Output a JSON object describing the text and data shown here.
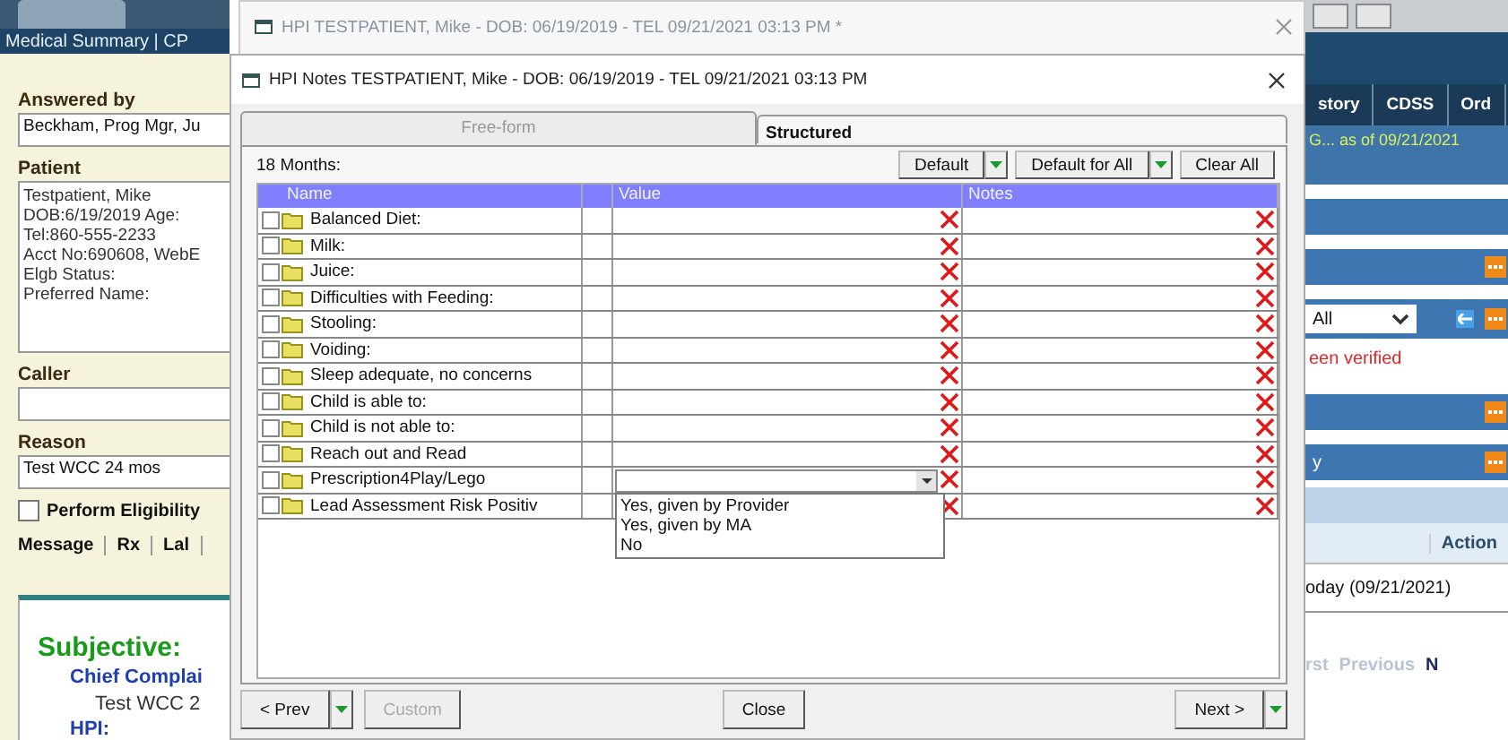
{
  "left_panel": {
    "nav_label": "Medical Summary | CP",
    "answered_by": {
      "label": "Answered by",
      "value": "Beckham, Prog Mgr, Ju"
    },
    "patient": {
      "label": "Patient",
      "lines": [
        "Testpatient, Mike",
        "DOB:6/19/2019  Age:",
        "Tel:860-555-2233",
        "Acct No:690608, WebE",
        "Elgb Status:",
        "Preferred Name:"
      ]
    },
    "caller": {
      "label": "Caller"
    },
    "reason": {
      "label": "Reason",
      "value": "Test WCC 24 mos"
    },
    "eligibility": {
      "label": "Perform Eligibility",
      "checked": false
    },
    "tabs": [
      "Message",
      "Rx",
      "Lal"
    ],
    "note": {
      "heading": "Subjective:",
      "subheading": "Chief Complai",
      "text": "Test WCC 2",
      "section": "HPI:"
    }
  },
  "right_panel": {
    "tabs": [
      "story",
      "CDSS",
      "Ord"
    ],
    "status": "G... as of 09/21/2021",
    "filter": {
      "value": "All"
    },
    "warning": "een verified",
    "bar_label": "y",
    "table": {
      "column": "Action",
      "cell": "oday (09/21/2021)"
    },
    "pager": [
      {
        "label": "rst",
        "disabled": true
      },
      {
        "label": "Previous",
        "disabled": true
      },
      {
        "label": "N",
        "disabled": false
      }
    ]
  },
  "back_window": {
    "title": "HPI TESTPATIENT, Mike - DOB: 06/19/2019 - TEL 09/21/2021 03:13 PM *"
  },
  "dialog": {
    "title": "HPI Notes TESTPATIENT, Mike - DOB: 06/19/2019 - TEL 09/21/2021 03:13 PM",
    "tabs": [
      {
        "label": "Free-form",
        "selected": false
      },
      {
        "label": "Structured",
        "selected": true
      }
    ],
    "section_label": "18 Months:",
    "toolbar": [
      {
        "label": "Default",
        "has_menu": true
      },
      {
        "label": "Default for All",
        "has_menu": true
      },
      {
        "label": "Clear All",
        "has_menu": false
      }
    ],
    "columns": [
      "Name",
      "Value",
      "Notes"
    ],
    "rows": [
      {
        "name": "Balanced Diet:",
        "checked": false,
        "kind": "text"
      },
      {
        "name": "Milk:",
        "checked": false,
        "kind": "text"
      },
      {
        "name": "Juice:",
        "checked": false,
        "kind": "text"
      },
      {
        "name": "Difficulties with Feeding:",
        "checked": false,
        "kind": "text"
      },
      {
        "name": "Stooling:",
        "checked": false,
        "kind": "text"
      },
      {
        "name": "Voiding:",
        "checked": false,
        "kind": "text"
      },
      {
        "name": "Sleep adequate, no concerns",
        "checked": false,
        "kind": "text"
      },
      {
        "name": "Child is able to:",
        "checked": false,
        "kind": "text"
      },
      {
        "name": "Child is not able to:",
        "checked": false,
        "kind": "text"
      },
      {
        "name": "Reach out and Read",
        "checked": false,
        "kind": "text"
      },
      {
        "name": "Prescription4Play/Lego",
        "checked": false,
        "kind": "dropdown",
        "expanded": true,
        "options": [
          "Yes, given by Provider",
          "Yes, given by MA",
          "No"
        ]
      },
      {
        "name": "Lead Assessment Risk Positiv",
        "checked": false,
        "kind": "text"
      }
    ],
    "footer": {
      "left": [
        {
          "label": "< Prev",
          "has_menu": true,
          "disabled": false
        },
        {
          "label": "Custom",
          "has_menu": false,
          "disabled": true
        }
      ],
      "center": [
        {
          "label": "Close",
          "has_menu": false,
          "disabled": false
        }
      ],
      "right": [
        {
          "label": "Next >",
          "has_menu": true,
          "disabled": false
        }
      ]
    }
  }
}
